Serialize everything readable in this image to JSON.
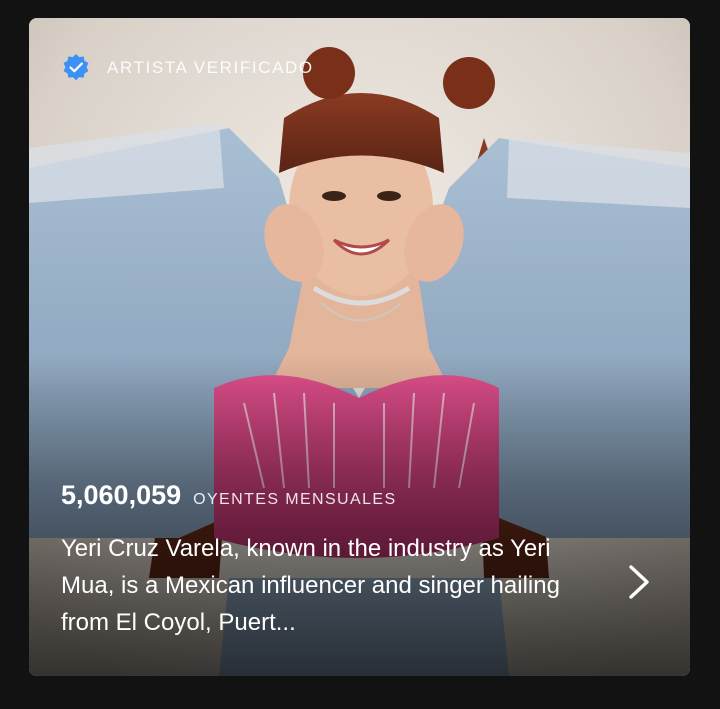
{
  "artist_card": {
    "verified_label": "ARTISTA VERIFICADO",
    "listeners_count": "5,060,059",
    "listeners_label": "OYENTES MENSUALES",
    "bio": "Yeri Cruz Varela, known in the industry as Yeri Mua, is a Mexican influencer and singer hailing from El Coyol, Puert...",
    "photo_description_icon": "artist-photo",
    "badge_icon": "verified-badge-icon",
    "chevron_icon": "chevron-right-icon"
  },
  "colors": {
    "page_background": "#121212",
    "badge_blue": "#3d91f4",
    "text": "#ffffff"
  }
}
